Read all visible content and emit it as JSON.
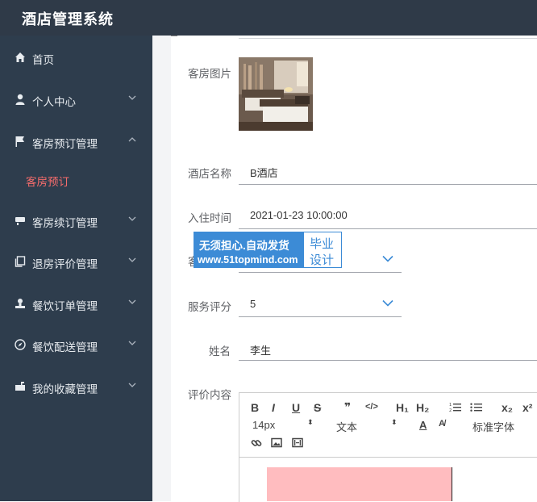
{
  "app": {
    "title": "酒店管理系统"
  },
  "sidebar": {
    "items": [
      {
        "label": "首页",
        "icon": "home-icon"
      },
      {
        "label": "个人中心",
        "icon": "user-icon"
      },
      {
        "label": "客房预订管理",
        "icon": "flag-icon",
        "sub": "客房预订"
      },
      {
        "label": "客房续订管理",
        "icon": "cup-icon"
      },
      {
        "label": "退房评价管理",
        "icon": "copy-icon"
      },
      {
        "label": "餐饮订单管理",
        "icon": "person-icon"
      },
      {
        "label": "餐饮配送管理",
        "icon": "compass-icon"
      },
      {
        "label": "我的收藏管理",
        "icon": "mailbox-icon"
      }
    ]
  },
  "form": {
    "room_image_label": "客房图片",
    "hotel_name_label": "酒店名称",
    "hotel_name": "B酒店",
    "checkin_label": "入住时间",
    "checkin": "2021-01-23 10:00:00",
    "room_type_label_partial": "客",
    "rating_label": "服务评分",
    "rating": "5",
    "name_label": "姓名",
    "name": "李生",
    "review_label": "评价内容"
  },
  "watermark": {
    "line1": "无须担心.自动发货",
    "line2": "www.51topmind.com",
    "right1": "毕业",
    "right2": "设计"
  },
  "editor": {
    "toolbar": {
      "bold": "B",
      "italic": "I",
      "underline": "U",
      "strike": "S",
      "quote": "❞",
      "code": "</>",
      "h1": "H₁",
      "h2": "H₂",
      "sub": "x₂",
      "sup": "x²",
      "size": "14px",
      "format": "文本",
      "font": "标准字体"
    }
  },
  "colors": {
    "sidebar": "#2e3d4d",
    "topbar": "#2f3a48",
    "active": "#f56c6c",
    "watermark": "#3c8bd6"
  }
}
